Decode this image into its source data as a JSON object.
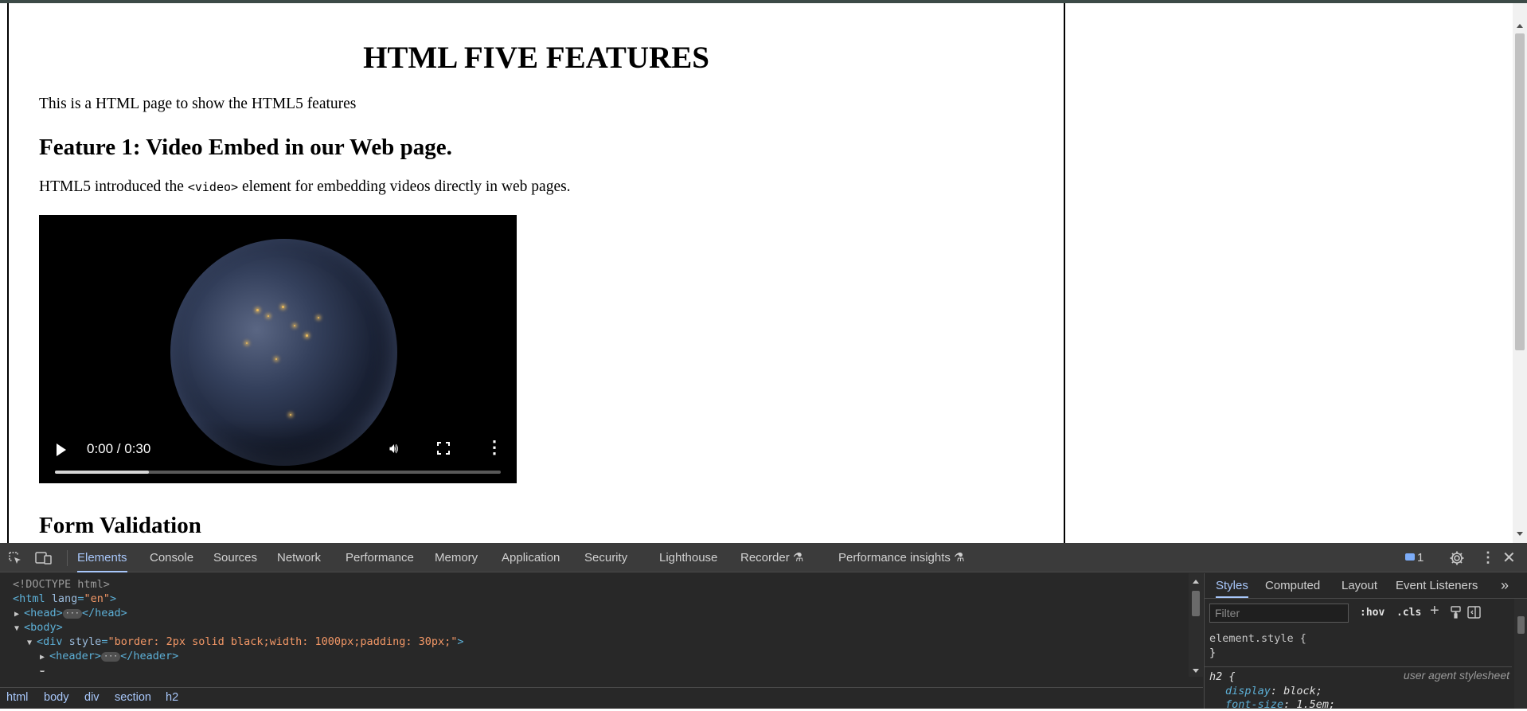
{
  "page": {
    "title": "HTML FIVE FEATURES",
    "intro": "This is a HTML page to show the HTML5 features",
    "feature1_heading": "Feature 1: Video Embed in our Web page.",
    "feature1_text_before": "HTML5 introduced the ",
    "feature1_code": "<video>",
    "feature1_text_after": " element for embedding videos directly in web pages.",
    "form_heading": "Form Validation"
  },
  "video": {
    "time": "0:00 / 0:30",
    "buffered_fraction": 0.21,
    "play_icon": "play-icon",
    "volume_icon": "volume-icon",
    "fullscreen_icon": "fullscreen-icon",
    "more_icon": "more-vertical-icon"
  },
  "devtools": {
    "tabs": [
      "Elements",
      "Console",
      "Sources",
      "Network",
      "Performance",
      "Memory",
      "Application",
      "Security",
      "Lighthouse",
      "Recorder ⚗",
      "Performance insights ⚗"
    ],
    "active_tab": "Elements",
    "issues_count": "1",
    "dom": {
      "doctype": "<!DOCTYPE html>",
      "html_open": "html",
      "html_attr": "lang",
      "html_attr_value": "\"en\"",
      "head": "head",
      "body": "body",
      "div": "div",
      "div_attr": "style",
      "div_attr_value": "\"border: 2px solid black;width: 1000px;padding: 30px;\"",
      "header": "header"
    },
    "breadcrumbs": [
      "html",
      "body",
      "div",
      "section",
      "h2"
    ],
    "styles": {
      "tabs": [
        "Styles",
        "Computed",
        "Layout",
        "Event Listeners"
      ],
      "active_tab": "Styles",
      "filter_placeholder": "Filter",
      "hov_label": ":hov",
      "cls_label": ".cls",
      "element_style_selector": "element.style {",
      "close_brace": "}",
      "h2_selector": "h2 {",
      "user_agent_label": "user agent stylesheet",
      "props": [
        {
          "name": "display",
          "value": "block;"
        },
        {
          "name": "font-size",
          "value": "1.5em;"
        }
      ]
    },
    "colors": {
      "active_blue": "#a8c7fa",
      "panel_bg": "#282828",
      "toolbar_bg": "#3b3b3b"
    }
  }
}
